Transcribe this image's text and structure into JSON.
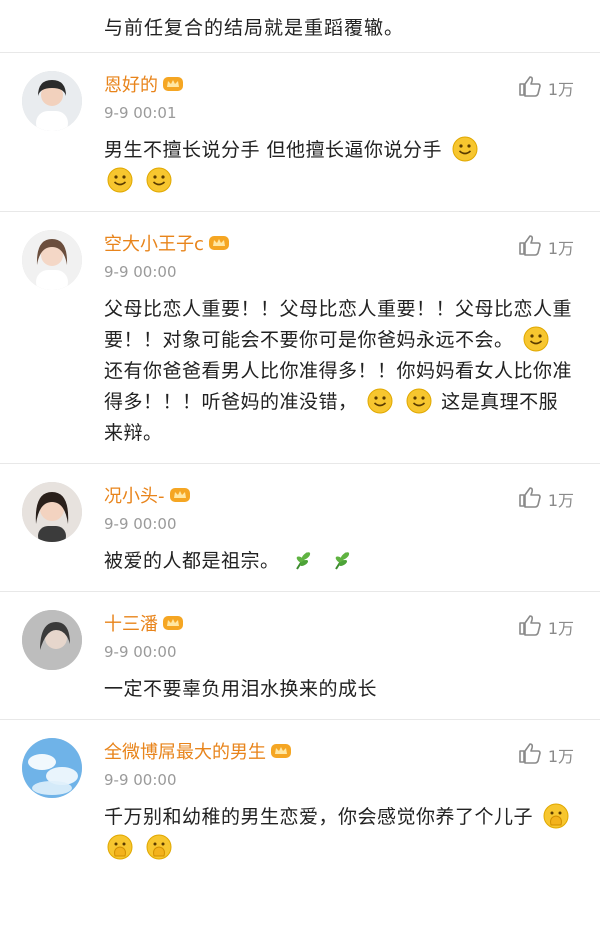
{
  "top_snippet": "与前任复合的结局就是重蹈覆辙。",
  "comments": [
    {
      "username": "恩好的",
      "time": "9-9 00:01",
      "likes": "1万",
      "text": "男生不擅长说分手 但他擅长逼你说分手",
      "emojis": [
        "smile",
        "smile",
        "smile"
      ]
    },
    {
      "username": "空大小王子c",
      "time": "9-9 00:00",
      "likes": "1万",
      "text_part1": "父母比恋人重要！！父母比恋人重要！！父母比恋人重要！！对象可能会不要你可是你爸妈永远不会。",
      "text_part2": "还有你爸爸看男人比你准得多！！你妈妈看女人比你准得多！！！听爸妈的准没错，",
      "text_part3": "这是真理不服来辩。",
      "emojis": [
        "smile",
        "smile",
        "smile"
      ]
    },
    {
      "username": "况小头-",
      "time": "9-9 00:00",
      "likes": "1万",
      "text": "被爱的人都是祖宗。",
      "emojis": [
        "plant",
        "plant"
      ]
    },
    {
      "username": "十三潘",
      "time": "9-9 00:00",
      "likes": "1万",
      "text": "一定不要辜负用泪水换来的成长",
      "emojis": []
    },
    {
      "username": "全微博屌最大的男生",
      "time": "9-9 00:00",
      "likes": "1万",
      "text": "千万别和幼稚的男生恋爱，你会感觉你养了个儿子",
      "emojis": [
        "hand-face",
        "hand-face",
        "hand-face"
      ]
    }
  ],
  "icons": {
    "like": "thumbs-up-outline-icon",
    "vip": "vip-crown-badge-icon",
    "smile": "smile-emoji-icon",
    "plant": "plant-emoji-icon",
    "hand_face": "hand-over-face-emoji-icon"
  },
  "colors": {
    "username": "#e8841b",
    "time": "#9a9a9a",
    "text": "#222222",
    "divider": "#e8e8e8",
    "emoji_yellow": "#f7c62f"
  }
}
